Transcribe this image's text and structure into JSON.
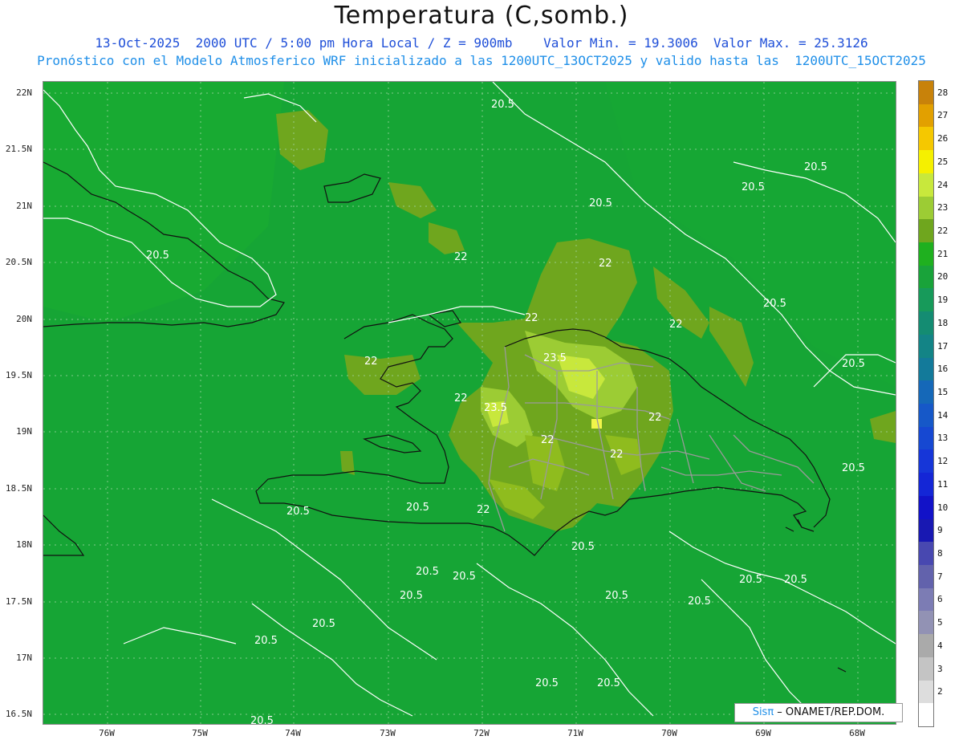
{
  "header": {
    "title": "Temperatura (C,somb.)",
    "line1": "13-Oct-2025  2000 UTC / 5:00 pm Hora Local / Z = 900mb    Valor Min. = 19.3006  Valor Max. = 25.3126",
    "line2": "Pronóstico con el Modelo Atmosferico WRF inicializado a las 1200UTC_13OCT2025 y valido hasta las  1200UTC_15OCT2025"
  },
  "map": {
    "lat_labels": [
      "22N",
      "21.5N",
      "21N",
      "20.5N",
      "20N",
      "19.5N",
      "19N",
      "18.5N",
      "18N",
      "17.5N",
      "17N",
      "16.5N"
    ],
    "lon_labels": [
      "76W",
      "75W",
      "74W",
      "73W",
      "72W",
      "71W",
      "70W",
      "69W",
      "68W"
    ],
    "contour_labels": [
      "20.5",
      "22",
      "23.5"
    ],
    "colors": {
      "ocean": "#16a535",
      "level_21": "#1fb01f",
      "level_22": "#6fa61e",
      "level_23": "#8fbc1e",
      "level_24": "#b2d83a",
      "level_25": "#e0f040"
    }
  },
  "colorbar": {
    "labels": [
      "28",
      "27",
      "26",
      "25",
      "24",
      "23",
      "22",
      "21",
      "20",
      "19",
      "18",
      "17",
      "16",
      "15",
      "14",
      "13",
      "12",
      "11",
      "10",
      "9",
      "8",
      "7",
      "6",
      "5",
      "4",
      "3",
      "2"
    ],
    "colors": [
      "#c8820a",
      "#e2a000",
      "#f5c800",
      "#f5f000",
      "#c8e83c",
      "#9ccc34",
      "#6fa61e",
      "#1fb01f",
      "#19a33a",
      "#179a5a",
      "#148c72",
      "#138486",
      "#137a9a",
      "#1568b8",
      "#1658c8",
      "#1648d2",
      "#1636d8",
      "#1426d6",
      "#1212c8",
      "#1818b2",
      "#4848b0",
      "#6262ac",
      "#7c7cb4",
      "#9292b4",
      "#aaaaaa",
      "#c4c4c4",
      "#dddddd",
      "#ffffff"
    ]
  },
  "logo": {
    "brand": "Sisπ",
    "text": " – ONAMET/REP.DOM."
  }
}
